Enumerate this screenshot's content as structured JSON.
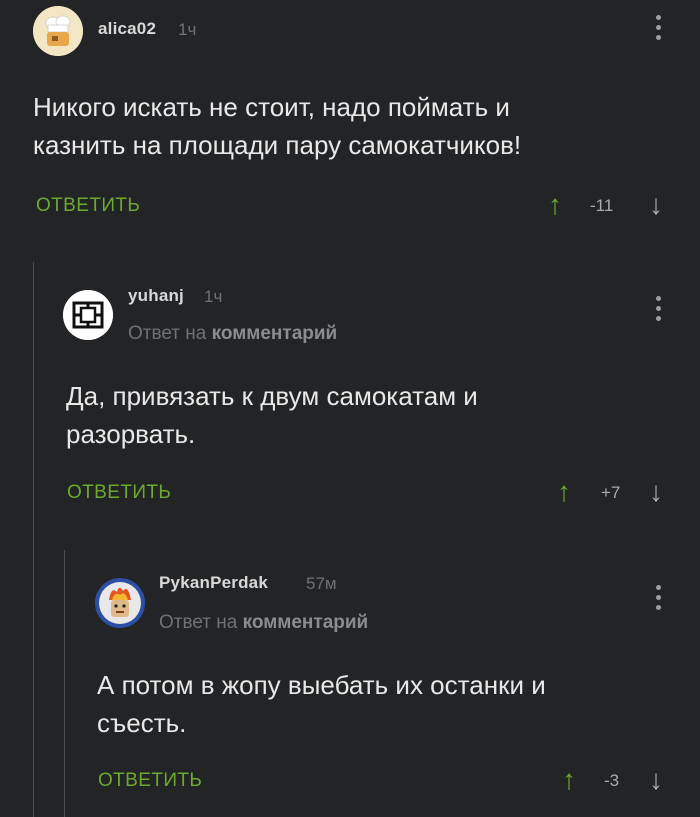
{
  "comments": [
    {
      "username": "alica02",
      "time": "1ч",
      "text_line1": "Никого искать не стоит,  надо поймать и",
      "text_line2": "казнить на площади пару самокатчиков!",
      "reply_label": "ОТВЕТИТЬ",
      "rating": "-11",
      "avatar_icon": "chef-icon"
    },
    {
      "username": "yuhanj",
      "time": "1ч",
      "reply_to_prefix": "Ответ на",
      "reply_to_link": "комментарий",
      "text_line1": "Да, привязать к двум самокатам и",
      "text_line2": "разорвать.",
      "reply_label": "ОТВЕТИТЬ",
      "rating": "+7",
      "avatar_icon": "rammstein-logo-icon"
    },
    {
      "username": "PykanPerdak",
      "time": "57м",
      "reply_to_prefix": "Ответ на",
      "reply_to_link": "комментарий",
      "text_line1": "А потом в жопу выебать их останки и",
      "text_line2": "съесть.",
      "reply_label": "ОТВЕТИТЬ",
      "rating": "-3",
      "avatar_icon": "burning-face-icon"
    }
  ],
  "icons": {
    "up": "↑",
    "down": "↓"
  },
  "colors": {
    "background": "#222426",
    "accent_green": "#6da82f",
    "muted": "#6f7275"
  }
}
